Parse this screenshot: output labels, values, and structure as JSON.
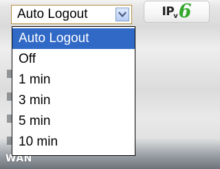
{
  "logout_select": {
    "value": "Auto Logout",
    "options": [
      "Auto Logout",
      "Off",
      "1 min",
      "3 min",
      "5 min",
      "10 min"
    ],
    "selected_index": 0,
    "arrow_icon": "chevron-down-icon"
  },
  "ipv6_badge": {
    "ip": "IP",
    "v": "v",
    "six": "6"
  },
  "background": {
    "wan_label": "WAN"
  },
  "colors": {
    "highlight": "#3169c6",
    "select_border": "#b38b3c",
    "six_green": "#31a82a"
  }
}
